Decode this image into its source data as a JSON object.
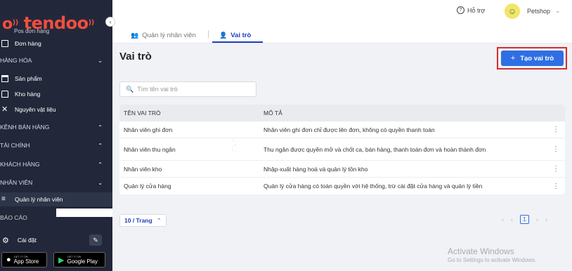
{
  "brand": {
    "logo_text": "tendoo",
    "overlap_text": "Pos đơn hàng"
  },
  "sidebar": {
    "items": [
      {
        "label": "Đơn hàng"
      },
      {
        "label": "HÀNG HÓA"
      },
      {
        "label": "Sản phẩm"
      },
      {
        "label": "Kho hàng"
      },
      {
        "label": "Nguyên vật liệu"
      },
      {
        "label": "KÊNH BÁN HÀNG"
      },
      {
        "label": "TÀI CHÍNH"
      },
      {
        "label": "KHÁCH HÀNG"
      },
      {
        "label": "NHÂN VIÊN"
      },
      {
        "label": "Quản lý nhân viên"
      },
      {
        "label": "BÁO CÁO"
      }
    ],
    "settings_label": "Cài đặt",
    "app_store": {
      "small": "GET IT ON",
      "big": "App Store"
    },
    "google_play": {
      "small": "GET IT ON",
      "big": "Google Play"
    }
  },
  "header": {
    "help_label": "Hỗ trợ",
    "shop_name": "Petshop",
    "tabs": [
      {
        "label": "Quản lý nhân viên"
      },
      {
        "label": "Vai trò"
      }
    ]
  },
  "main": {
    "title": "Vai trò",
    "create_button": "Tạo vai trò",
    "search_placeholder": "Tìm tên vai trò",
    "table": {
      "columns": [
        "TÊN VAI TRÒ",
        "MÔ TẢ"
      ],
      "rows": [
        {
          "name": "Nhân viên ghi đơn",
          "desc": "Nhân viên ghi đơn chỉ được lên đơn, không có quyền thanh toán"
        },
        {
          "name": "Nhân viên thu ngân",
          "desc": "Thu ngân được quyền mở và chốt ca, bán hàng, thanh toán đơn và hoàn thành đơn"
        },
        {
          "name": "Nhân viên kho",
          "desc": "Nhập-xuất hàng hoá và quản lý tồn kho"
        },
        {
          "name": "Quản lý cửa hàng",
          "desc": "Quản lý cửa hàng có toàn quyền với hệ thống, trừ cài đặt cửa hàng và quản lý tiền"
        }
      ]
    },
    "page_size": "10 / Trang",
    "current_page": "1"
  },
  "watermark": {
    "line1": "Activate Windows",
    "line2": "Go to Settings to activate Windows."
  },
  "colors": {
    "accent": "#2f6fe3",
    "sidebar_bg": "#22283a",
    "brand": "#f04e3e",
    "highlight": "#d32f2f"
  }
}
